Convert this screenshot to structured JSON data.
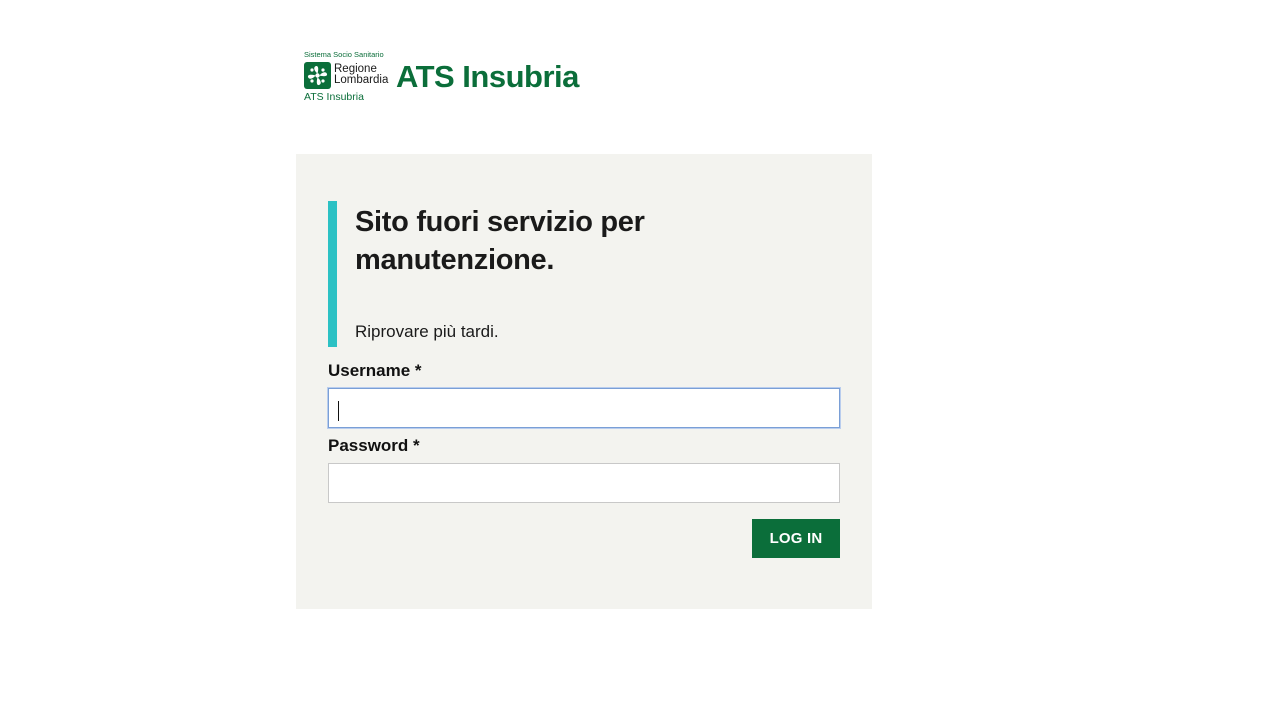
{
  "logo": {
    "top_text": "Sistema Socio Sanitario",
    "region_line1": "Regione",
    "region_line2": "Lombardia",
    "bottom_text": "ATS Insubria",
    "icon": "lombardia-rose-icon"
  },
  "header": {
    "brand_title": "ATS Insubria"
  },
  "notice": {
    "title": "Sito fuori servizio per manutenzione.",
    "message": "Riprovare più tardi."
  },
  "form": {
    "username_label": "Username *",
    "username_value": "",
    "password_label": "Password *",
    "password_value": "",
    "submit_label": "LOG IN"
  },
  "colors": {
    "brand_green": "#0b6e3a",
    "notice_accent": "#2bc1c4",
    "card_background": "#f3f3ef"
  }
}
